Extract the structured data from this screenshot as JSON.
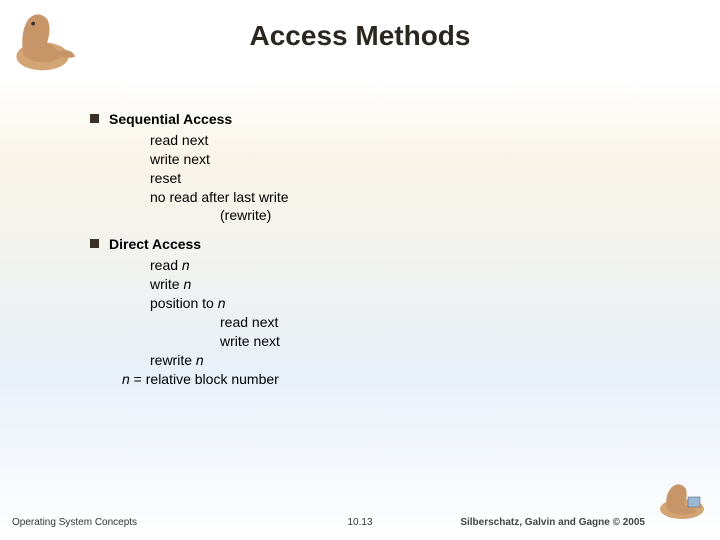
{
  "title": "Access Methods",
  "sections": [
    {
      "heading": "Sequential Access",
      "lines": [
        {
          "text": "read next",
          "indent": "sub1"
        },
        {
          "text": "write next",
          "indent": "sub1"
        },
        {
          "text": "reset",
          "indent": "sub1"
        },
        {
          "text": "no read after last write",
          "indent": "sub1"
        },
        {
          "text": "(rewrite)",
          "indent": "sub2"
        }
      ]
    },
    {
      "heading": "Direct Access",
      "lines": [
        {
          "text": "read n",
          "indent": "sub1",
          "italic_last": true
        },
        {
          "text": "write n",
          "indent": "sub1",
          "italic_last": true
        },
        {
          "text": "position to n",
          "indent": "sub1",
          "italic_last": true
        },
        {
          "text": "read next",
          "indent": "sub2"
        },
        {
          "text": "write next",
          "indent": "sub2"
        },
        {
          "text": "rewrite n",
          "indent": "sub1",
          "italic_last": true
        }
      ],
      "note": {
        "prefix": "n",
        "rest": " = relative block number"
      }
    }
  ],
  "footer": {
    "left": "Operating System Concepts",
    "center": "10.13",
    "right": "Silberschatz, Galvin and Gagne © 2005"
  }
}
